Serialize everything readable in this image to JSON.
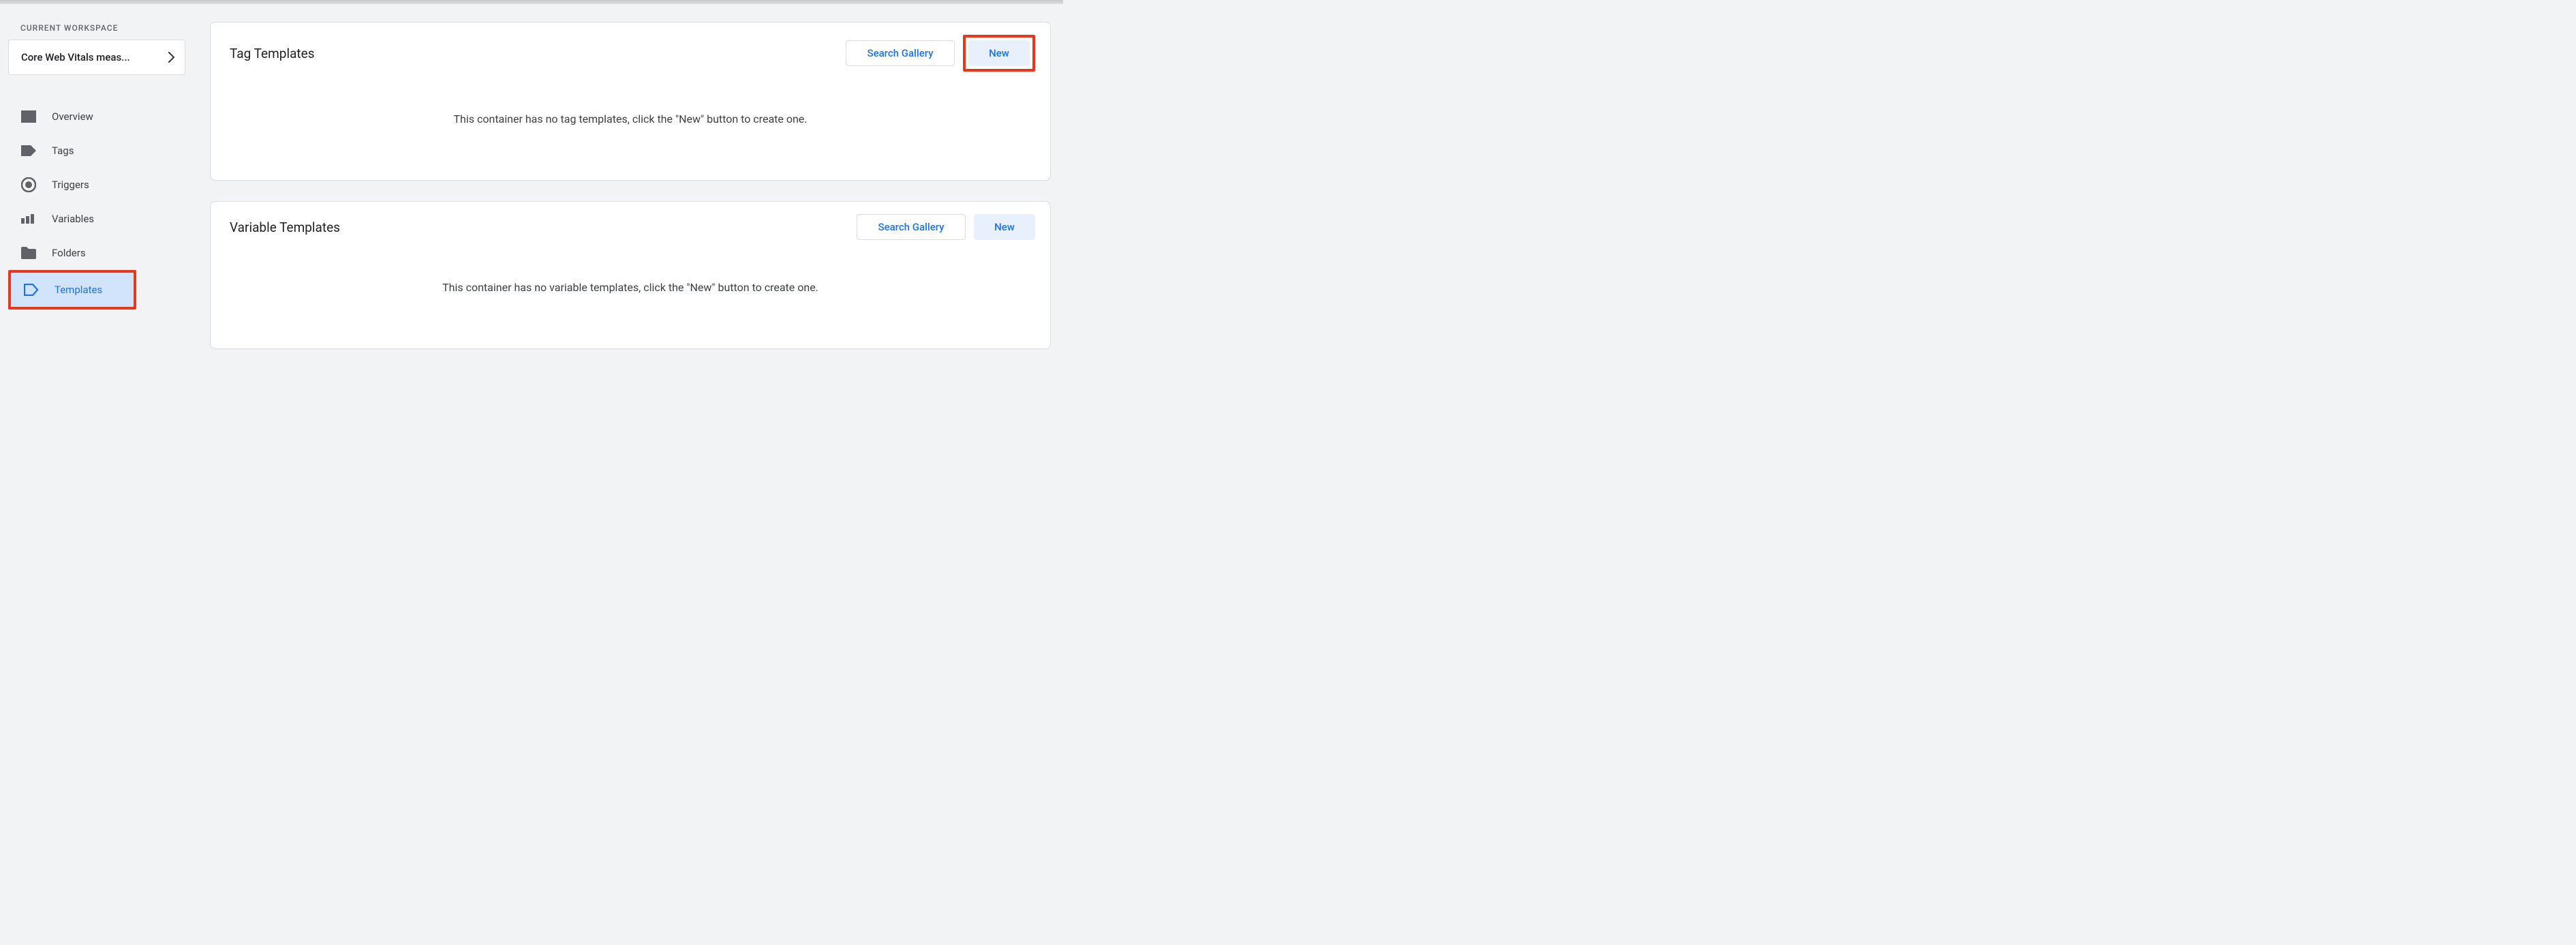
{
  "sidebar": {
    "workspace_label": "CURRENT WORKSPACE",
    "workspace_name": "Core Web Vitals meas...",
    "items": [
      {
        "label": "Overview"
      },
      {
        "label": "Tags"
      },
      {
        "label": "Triggers"
      },
      {
        "label": "Variables"
      },
      {
        "label": "Folders"
      },
      {
        "label": "Templates"
      }
    ]
  },
  "cards": {
    "tag": {
      "title": "Tag Templates",
      "gallery_label": "Search Gallery",
      "new_label": "New",
      "empty_msg": "This container has no tag templates, click the \"New\" button to create one."
    },
    "variable": {
      "title": "Variable Templates",
      "gallery_label": "Search Gallery",
      "new_label": "New",
      "empty_msg": "This container has no variable templates, click the \"New\" button to create one."
    }
  }
}
